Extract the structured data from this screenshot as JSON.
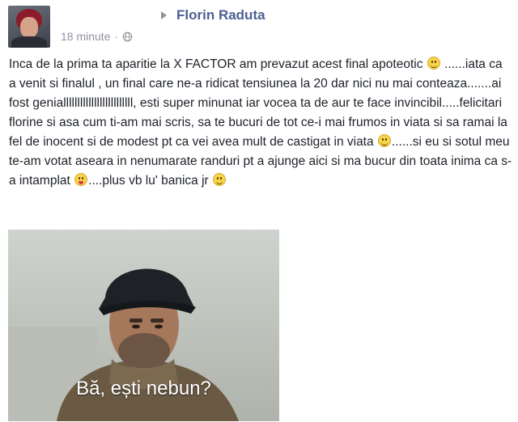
{
  "post": {
    "author": "Florin Raduta",
    "timestamp": "18 minute",
    "separator": "·",
    "privacy_icon": "globe-icon",
    "text_segments": [
      "Inca de la prima ta aparitie la X FACTOR am prevazut acest final apoteotic ",
      " ......iata ca a venit si finalul , un final care ne-a ridicat tensiunea la 20 dar nici nu mai conteaza.......ai fost genialllllllllllllllllllllllll, esti super minunat iar vocea ta de aur te face invincibil.....felicitari florine si asa cum ti-am mai scris, sa te bucuri de tot ce-i mai frumos in viata si sa ramai la fel de inocent si de modest pt ca vei avea mult de castigat in viata ",
      "......si eu si sotul meu te-am votat aseara in nenumarate randuri pt a ajunge aici si ma bucur din toata inima ca s-a intamplat ",
      "....plus vb lu' banica jr "
    ],
    "emoji_icons": [
      "smile-emoji-icon",
      "smile-emoji-icon",
      "tongue-emoji-icon",
      "smile-emoji-icon"
    ],
    "image_caption": "Bă, ești nebun?"
  },
  "colors": {
    "author_link": "#4b5f93",
    "meta_gray": "#90949c",
    "text": "#1d2129"
  }
}
